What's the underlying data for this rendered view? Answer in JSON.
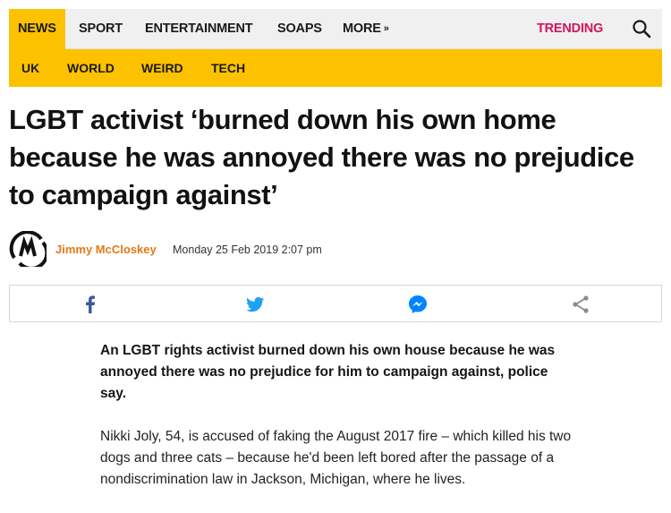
{
  "topnav": {
    "items": [
      "NEWS",
      "SPORT",
      "ENTERTAINMENT",
      "SOAPS",
      "MORE"
    ],
    "more_chevron": "»",
    "trending": "TRENDING",
    "search_icon": "search-icon"
  },
  "subnav": {
    "items": [
      "UK",
      "WORLD",
      "WEIRD",
      "TECH"
    ]
  },
  "article": {
    "headline": "LGBT activist ‘burned down his own home because he was annoyed there was no prejudice to campaign against’",
    "author": "Jimmy McCloskey",
    "date": "Monday 25 Feb 2019 2:07 pm",
    "lede": "An LGBT rights activist burned down his own house because he was annoyed there was no prejudice for him to campaign against, police say.",
    "body": "Nikki Joly, 54, is accused of faking the August 2017 fire – which killed his two dogs and three cats – because he'd been left bored after the passage of a nondiscrimination law in Jackson, Michigan, where he lives."
  },
  "share": {
    "icons": [
      "facebook-icon",
      "twitter-icon",
      "messenger-icon",
      "share-icon"
    ]
  },
  "colors": {
    "accent_yellow": "#fcc200",
    "trending_pink": "#d3145a",
    "author_orange": "#e37a16",
    "facebook": "#3b5998",
    "twitter": "#1da1f2",
    "messenger": "#0084ff"
  }
}
